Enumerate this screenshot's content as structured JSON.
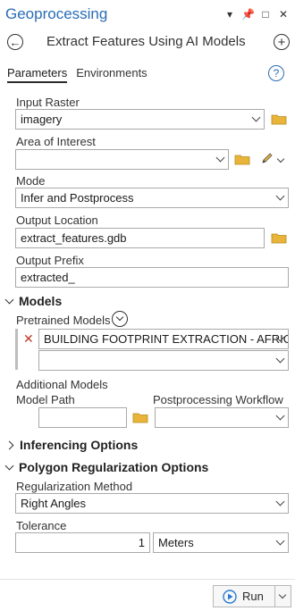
{
  "pane": {
    "title": "Geoprocessing"
  },
  "tool": {
    "title": "Extract Features Using AI Models"
  },
  "tabs": {
    "parameters": "Parameters",
    "environments": "Environments"
  },
  "params": {
    "input_raster": {
      "label": "Input Raster",
      "value": "imagery"
    },
    "area_of_interest": {
      "label": "Area of Interest",
      "value": ""
    },
    "mode": {
      "label": "Mode",
      "value": "Infer and Postprocess"
    },
    "output_location": {
      "label": "Output Location",
      "value": "extract_features.gdb"
    },
    "output_prefix": {
      "label": "Output Prefix",
      "value": "extracted_"
    }
  },
  "models": {
    "section": "Models",
    "pretrained_label": "Pretrained Models",
    "pretrained_items": [
      "BUILDING FOOTPRINT EXTRACTION - AFRICA",
      ""
    ],
    "additional_label": "Additional Models",
    "model_path_label": "Model Path",
    "model_path_value": "",
    "postprocessing_label": "Postprocessing Workflow",
    "postprocessing_value": ""
  },
  "inferencing": {
    "section": "Inferencing Options"
  },
  "regularization": {
    "section": "Polygon Regularization Options",
    "method_label": "Regularization Method",
    "method_value": "Right Angles",
    "tolerance_label": "Tolerance",
    "tolerance_value": "1",
    "tolerance_unit": "Meters"
  },
  "footer": {
    "run_label": "Run"
  },
  "colors": {
    "accent": "#2a6cb5",
    "folder": "#e8b53a",
    "remove_x": "#c0392b",
    "run_icon": "#2a7bd4"
  }
}
